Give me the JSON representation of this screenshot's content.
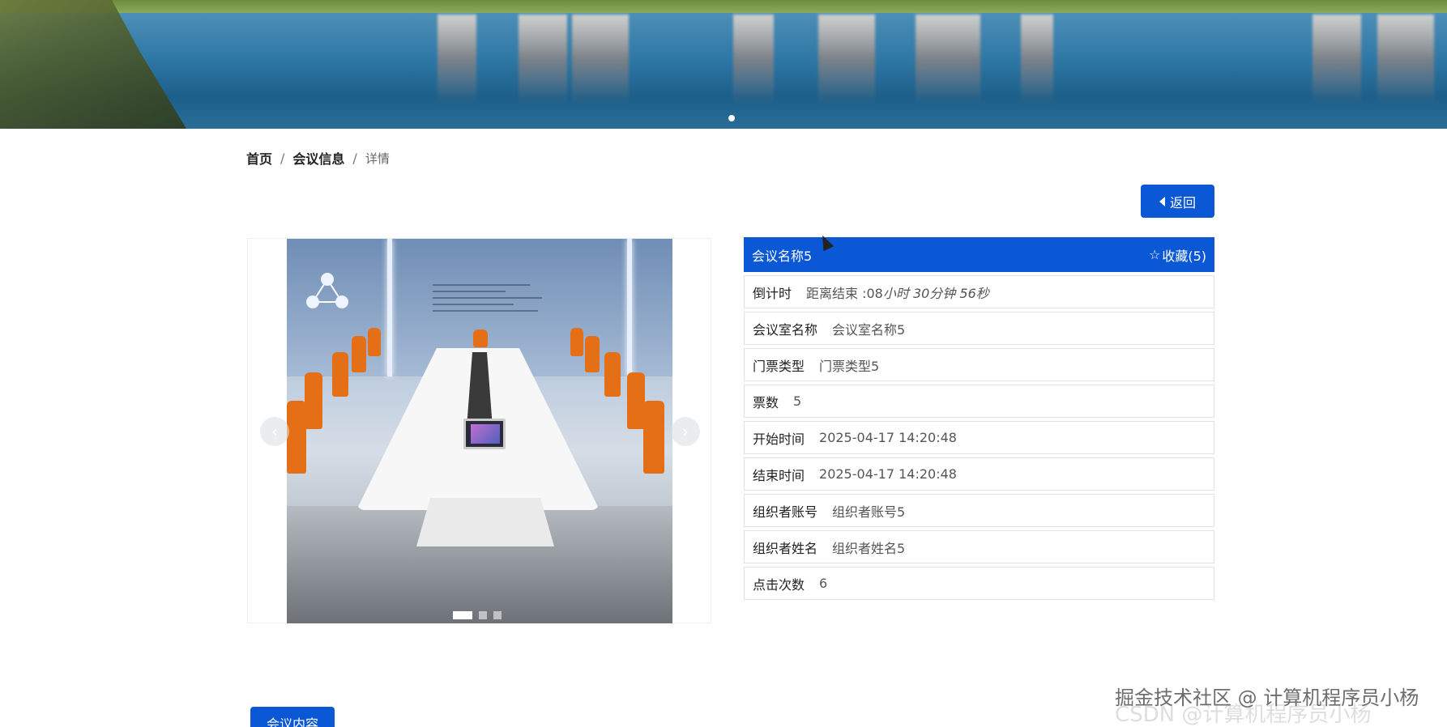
{
  "breadcrumb": {
    "home": "首页",
    "section": "会议信息",
    "current": "详情",
    "separator": "/"
  },
  "back_button": {
    "label": "返回",
    "icon": "caret-left-icon"
  },
  "carousel": {
    "prev_icon": "‹",
    "next_icon": "›",
    "slide_count": 3,
    "active_slide": 1
  },
  "detail": {
    "title": "会议名称5",
    "favorite_label": "收藏(5)",
    "favorite_icon": "☆",
    "rows": [
      {
        "label": "倒计时",
        "value_prefix": "距离结束 :08",
        "value_italic": "小时 30分钟 56秒"
      },
      {
        "label": "会议室名称",
        "value": "会议室名称5"
      },
      {
        "label": "门票类型",
        "value": "门票类型5"
      },
      {
        "label": "票数",
        "value": "5"
      },
      {
        "label": "开始时间",
        "value": "2025-04-17 14:20:48"
      },
      {
        "label": "结束时间",
        "value": "2025-04-17 14:20:48"
      },
      {
        "label": "组织者账号",
        "value": "组织者账号5"
      },
      {
        "label": "组织者姓名",
        "value": "组织者姓名5"
      },
      {
        "label": "点击次数",
        "value": "6"
      }
    ]
  },
  "tabs": {
    "content_label": "会议内容"
  },
  "watermark": {
    "text": "掘金技术社区 @ 计算机程序员小杨",
    "ghost": "CSDN @计算机程序员小杨"
  },
  "colors": {
    "primary": "#0a58d6"
  }
}
